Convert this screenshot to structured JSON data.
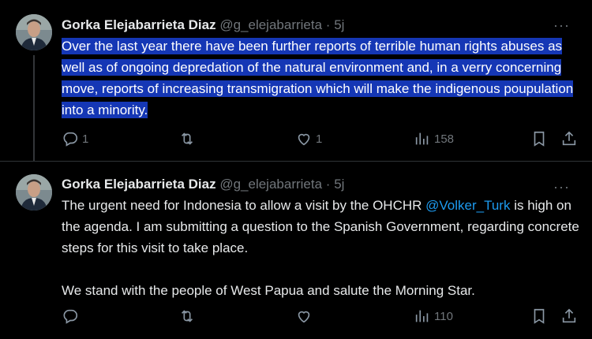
{
  "tweets": [
    {
      "author_name": "Gorka Elejabarrieta Diaz",
      "handle": "@g_elejabarrieta",
      "separator": "·",
      "time": "5j",
      "more": "···",
      "text": "Over the last year there have been further reports of terrible human rights abuses as well as of ongoing depredation of the natural environment and, in a verry concerning move, reports of increasing transmigration which will make the indigenous poupulation into a minority.",
      "text_selected": true,
      "replies": "1",
      "retweets": "",
      "likes": "1",
      "views": "158"
    },
    {
      "author_name": "Gorka Elejabarrieta Diaz",
      "handle": "@g_elejabarrieta",
      "separator": "·",
      "time": "5j",
      "more": "···",
      "text_before_mention": "The urgent need for Indonesia to allow a visit by the OHCHR ",
      "mention": "@Volker_Turk",
      "text_after_mention": " is high on the agenda. I am submitting a question to the Spanish Government, regarding concrete steps for this visit to take place.",
      "text_paragraph2": "We stand with the people of West Papua and salute the Morning Star.",
      "replies": "",
      "retweets": "",
      "likes": "",
      "views": "110"
    }
  ],
  "colors": {
    "background": "#000000",
    "text": "#e7e9ea",
    "secondary": "#71767b",
    "selection": "#1537b5",
    "link": "#1d9bf0",
    "divider": "#2f3336"
  },
  "icons": [
    "reply-icon",
    "retweet-icon",
    "like-icon",
    "views-icon",
    "bookmark-icon",
    "share-icon",
    "more-icon"
  ]
}
